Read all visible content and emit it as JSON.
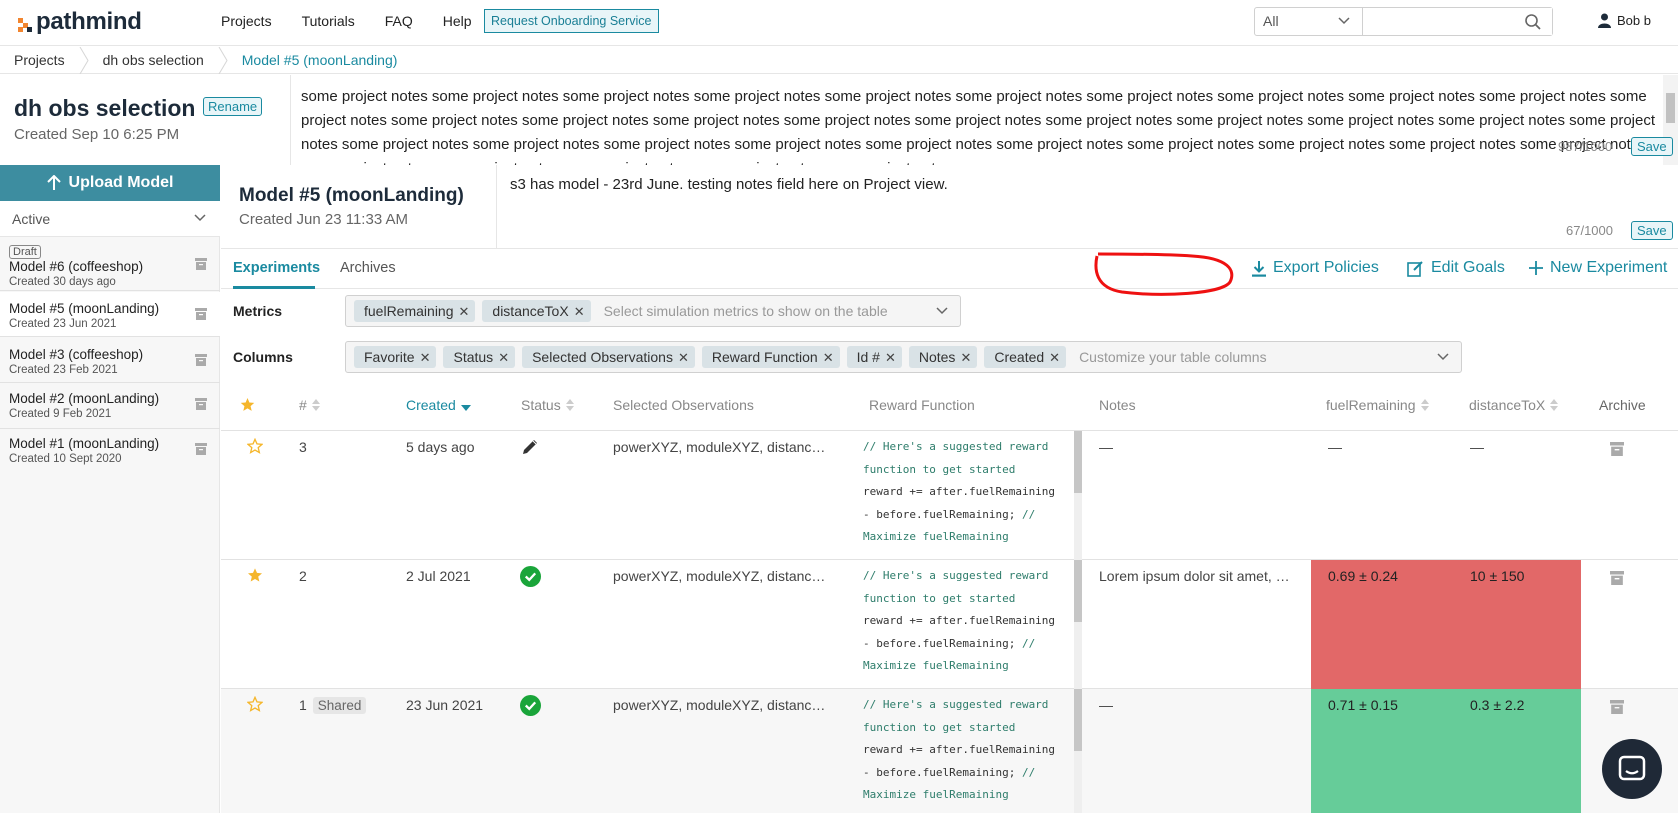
{
  "brand": {
    "name": "pathmind"
  },
  "nav": {
    "items": [
      "Projects",
      "Tutorials",
      "FAQ",
      "Help"
    ],
    "onboarding_label": "Request Onboarding Service"
  },
  "search": {
    "scope": "All",
    "placeholder": ""
  },
  "user": {
    "name": "Bob b"
  },
  "breadcrumb": [
    "Projects",
    "dh obs selection",
    "Model #5 (moonLanding)"
  ],
  "project": {
    "title": "dh obs selection",
    "rename_label": "Rename",
    "created": "Created Sep 10 6:25 PM",
    "notes": "some project notes some project notes some project notes some project notes some project notes some project notes some project notes some project notes some project notes some project notes some project notes some project notes some project notes some project notes some project notes some project notes some project notes some project notes some project notes some project notes some project notes some project notes some project notes some project notes some project notes some project notes some project notes some project notes some project notes some project notes some project notes some project notes some project notes some project notes some project notes some project notes",
    "char_count": "987/1000",
    "save_label": "Save"
  },
  "sidebar": {
    "upload_label": "Upload Model",
    "filter_label": "Active",
    "draft_tag": "Draft",
    "models": [
      {
        "name": "Model #6 (coffeeshop)",
        "date": "Created 30 days ago"
      },
      {
        "name": "Model #5 (moonLanding)",
        "date": "Created 23 Jun 2021"
      },
      {
        "name": "Model #3 (coffeeshop)",
        "date": "Created 23 Feb 2021"
      },
      {
        "name": "Model #2 (moonLanding)",
        "date": "Created 9 Feb 2021"
      },
      {
        "name": "Model #1 (moonLanding)",
        "date": "Created 10 Sept 2020"
      }
    ]
  },
  "model": {
    "title": "Model #5 (moonLanding)",
    "created": "Created Jun 23 11:33 AM",
    "notes": "s3 has model - 23rd June. testing notes field here on Project view.",
    "char_count": "67/1000",
    "save_label": "Save"
  },
  "tabs": {
    "experiments": "Experiments",
    "archives": "Archives"
  },
  "actions": {
    "export": "Export Policies",
    "goals": "Edit Goals",
    "new": "New Experiment"
  },
  "metrics_filter": {
    "label": "Metrics",
    "chips": [
      "fuelRemaining",
      "distanceToX"
    ],
    "placeholder": "Select simulation metrics to show on the table"
  },
  "columns_filter": {
    "label": "Columns",
    "chips": [
      "Favorite",
      "Status",
      "Selected Observations",
      "Reward Function",
      "Id #",
      "Notes",
      "Created"
    ],
    "placeholder": "Customize your table columns"
  },
  "table": {
    "headers": {
      "num": "#",
      "created": "Created",
      "status": "Status",
      "observations": "Selected Observations",
      "reward": "Reward Function",
      "notes": "Notes",
      "fuel": "fuelRemaining",
      "distance": "distanceToX",
      "archive": "Archive"
    },
    "reward_code": {
      "l1": "// Here's a suggested reward",
      "l2": "function to get started",
      "l3": "reward += after.fuelRemaining",
      "l4a": "- before.fuelRemaining; ",
      "l4b": "//",
      "l5": "Maximize fuelRemaining"
    },
    "rows": [
      {
        "id": "3",
        "created": "5 days ago",
        "status": "draft",
        "observations": "powerXYZ, moduleXYZ, distanc…",
        "notes": "—",
        "fuel": "—",
        "distance": "—",
        "favorite": false,
        "shared": ""
      },
      {
        "id": "2",
        "created": "2 Jul 2021",
        "status": "completed",
        "observations": "powerXYZ, moduleXYZ, distanc…",
        "notes": "Lorem ipsum dolor sit amet, …",
        "fuel": "0.69  ±  0.24",
        "distance": "10  ±  150",
        "favorite": true,
        "shared": "",
        "metric_color": "#e26868"
      },
      {
        "id": "1",
        "created": "23 Jun 2021",
        "status": "completed",
        "observations": "powerXYZ, moduleXYZ, distanc…",
        "notes": "—",
        "fuel": "0.71  ±  0.15",
        "distance": "0.3  ±  2.2",
        "favorite": false,
        "shared": "Shared",
        "metric_color": "#66cc99"
      }
    ]
  },
  "colors": {
    "accent": "#1a8aa0",
    "star": "#f5b62b",
    "success": "#1aa53a",
    "bad": "#e26868",
    "good": "#66cc99"
  }
}
